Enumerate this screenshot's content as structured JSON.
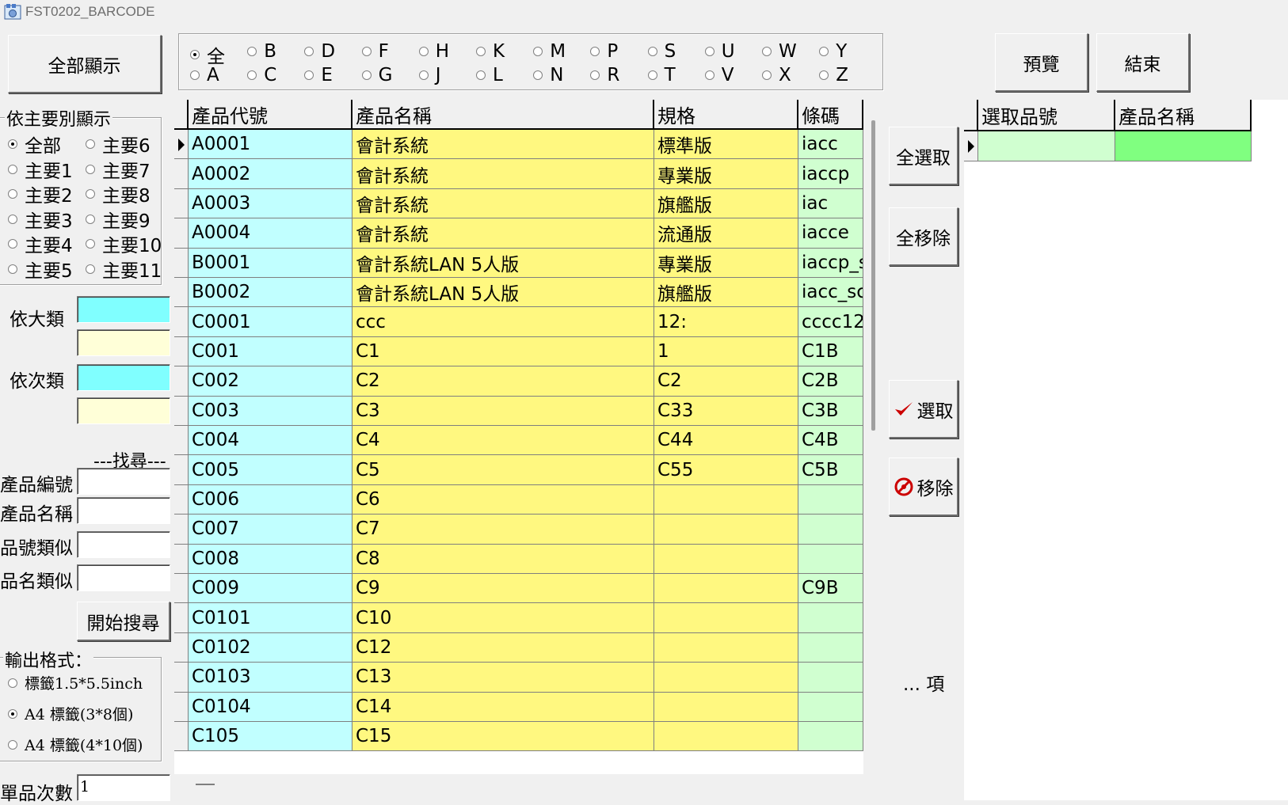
{
  "window": {
    "title": "FST0202_BARCODE"
  },
  "left": {
    "show_all": "全部顯示",
    "main_group_label": "依主要別顯示",
    "main_radios": [
      "全部",
      "主要6",
      "主要1",
      "主要7",
      "主要2",
      "主要8",
      "主要3",
      "主要9",
      "主要4",
      "主要10",
      "主要5",
      "主要11"
    ],
    "main_selected": "全部",
    "big_class_label": "依大類",
    "sub_class_label": "依次類",
    "search_header": "---找尋---",
    "search_fields": [
      "產品編號",
      "產品名稱",
      "品號類似",
      "品名類似"
    ],
    "search_button": "開始搜尋",
    "output_label": "輸出格式：",
    "output_options": [
      "標籤1.5*5.5inch",
      "A4 標籤(3*8個)",
      "A4 標籤(4*10個)"
    ],
    "output_selected": "A4 標籤(3*8個)",
    "count_label": "單品次數",
    "count_value": "1"
  },
  "letters": {
    "row1": [
      "全",
      "B",
      "D",
      "F",
      "H",
      "K",
      "M",
      "P",
      "S",
      "U",
      "W",
      "Y"
    ],
    "row2": [
      "A",
      "C",
      "E",
      "G",
      "J",
      "L",
      "N",
      "R",
      "T",
      "V",
      "X",
      "Z"
    ],
    "selected": "全"
  },
  "toolbar": {
    "preview": "預覽",
    "exit": "結束"
  },
  "grid": {
    "columns": [
      "產品代號",
      "產品名稱",
      "規格",
      "條碼"
    ],
    "rows": [
      [
        "A0001",
        "會計系統",
        "標準版",
        "iacc"
      ],
      [
        "A0002",
        "會計系統",
        "專業版",
        "iaccp"
      ],
      [
        "A0003",
        "會計系統",
        "旗艦版",
        "iac"
      ],
      [
        "A0004",
        "會計系統",
        "流通版",
        "iacce"
      ],
      [
        "B0001",
        "會計系統LAN 5人版",
        "專業版",
        "iaccp_s"
      ],
      [
        "B0002",
        "會計系統LAN 5人版",
        "旗艦版",
        "iacc_sc"
      ],
      [
        "C0001",
        "ccc",
        "12:",
        "cccc12"
      ],
      [
        "C001",
        "C1",
        "1",
        "C1B"
      ],
      [
        "C002",
        "C2",
        "C2",
        "C2B"
      ],
      [
        "C003",
        "C3",
        "C33",
        "C3B"
      ],
      [
        "C004",
        "C4",
        "C44",
        "C4B"
      ],
      [
        "C005",
        "C5",
        "C55",
        "C5B"
      ],
      [
        "C006",
        "C6",
        "",
        ""
      ],
      [
        "C007",
        "C7",
        "",
        ""
      ],
      [
        "C008",
        "C8",
        "",
        ""
      ],
      [
        "C009",
        "C9",
        "",
        "C9B"
      ],
      [
        "C0101",
        "C10",
        "",
        ""
      ],
      [
        "C0102",
        "C12",
        "",
        ""
      ],
      [
        "C0103",
        "C13",
        "",
        ""
      ],
      [
        "C0104",
        "C14",
        "",
        ""
      ],
      [
        "C105",
        "C15",
        "",
        ""
      ]
    ],
    "current_row": 0
  },
  "middle": {
    "select_all": "全選取",
    "remove_all": "全移除",
    "select": "選取",
    "remove": "移除",
    "count_text": "... 項"
  },
  "selected_grid": {
    "columns": [
      "選取品號",
      "產品名稱"
    ],
    "rows": [
      [
        "",
        ""
      ]
    ]
  },
  "colors": {
    "code_col": "#c1ffff",
    "name_col": "#fff880",
    "barcode_col": "#d0ffd0",
    "sel_name_col": "#80ff80",
    "check": "#cc0000"
  }
}
